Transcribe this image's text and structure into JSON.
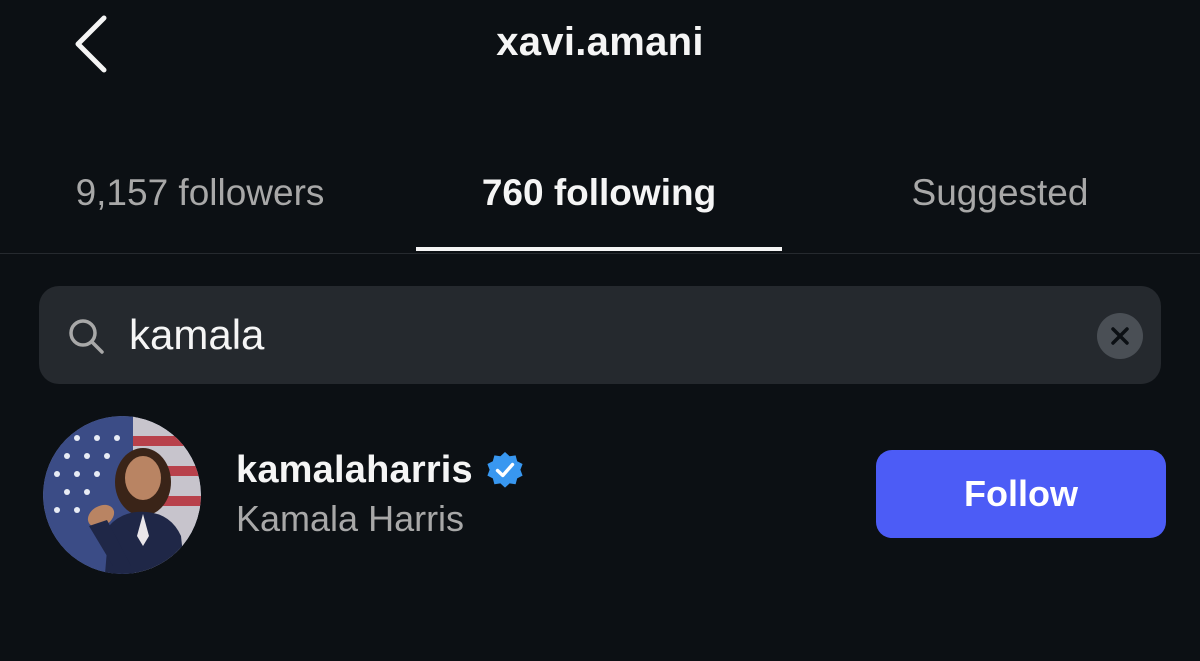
{
  "header": {
    "title": "xavi.amani",
    "back_icon": "chevron-left-icon"
  },
  "tabs": [
    {
      "label": "9,157 followers",
      "active": false
    },
    {
      "label": "760 following",
      "active": true
    },
    {
      "label": "Suggested",
      "active": false
    }
  ],
  "search": {
    "value": "kamala",
    "icon": "search-icon",
    "clear_icon": "clear-icon"
  },
  "results": [
    {
      "username": "kamalaharris",
      "full_name": "Kamala Harris",
      "verified": true,
      "button_label": "Follow"
    }
  ],
  "colors": {
    "background": "#0c1014",
    "search_bg": "#25292e",
    "follow_button": "#4c5cf6",
    "verified_badge": "#3897f0",
    "secondary_text": "#a8a8a8"
  }
}
